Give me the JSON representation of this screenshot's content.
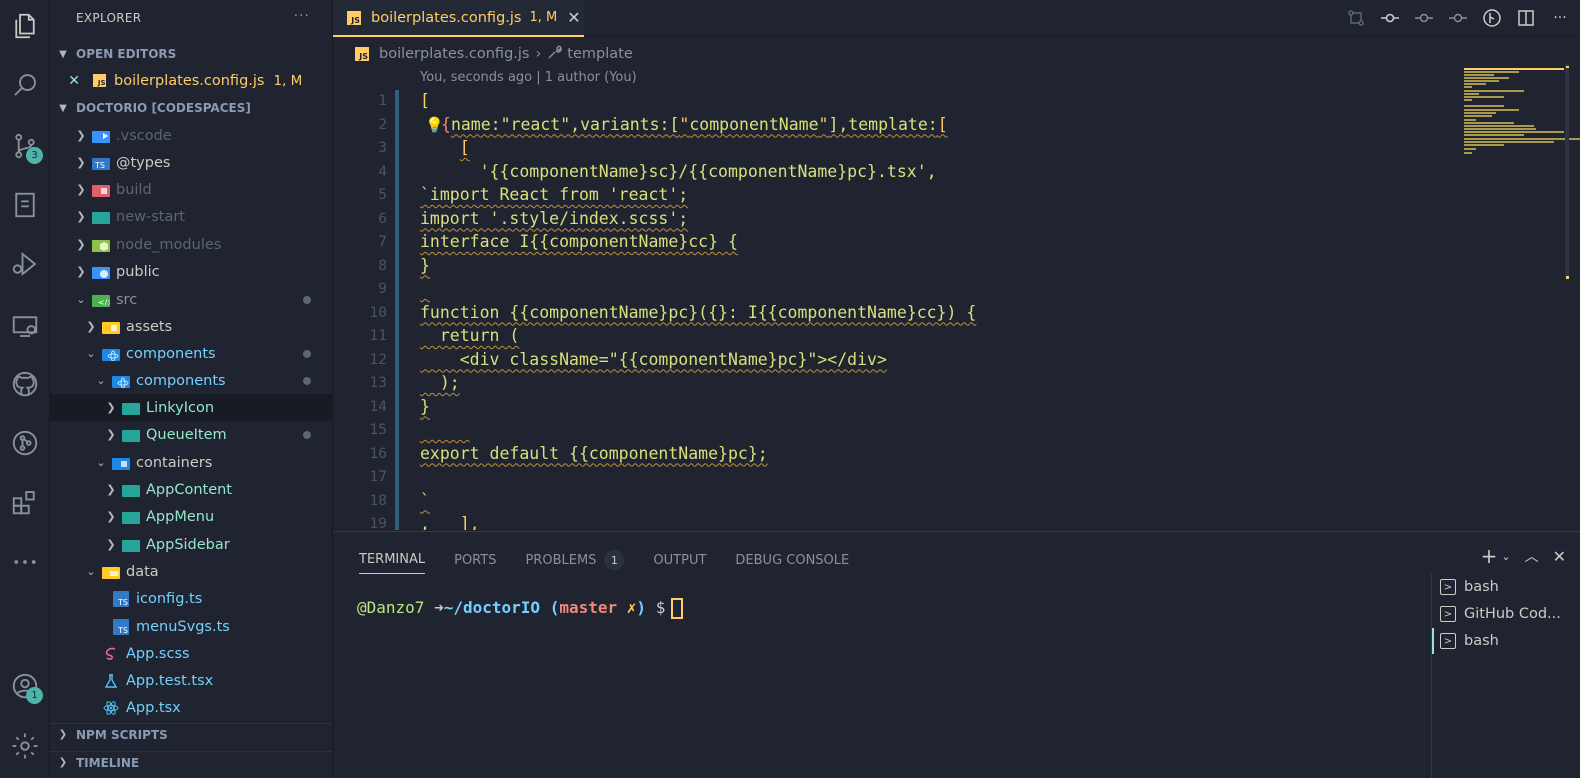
{
  "explorer": {
    "title": "EXPLORER",
    "more": "···",
    "open_editors": {
      "label": "OPEN EDITORS",
      "file": "boilerplates.config.js",
      "status": "1, M"
    },
    "workspace": {
      "label": "DOCTORIO [CODESPACES]"
    },
    "tree": [
      {
        "label": ".vscode"
      },
      {
        "label": "@types"
      },
      {
        "label": "build"
      },
      {
        "label": "new-start"
      },
      {
        "label": "node_modules"
      },
      {
        "label": "public"
      },
      {
        "label": "src"
      },
      {
        "label": "assets"
      },
      {
        "label": "components"
      },
      {
        "label": "components"
      },
      {
        "label": "LinkyIcon"
      },
      {
        "label": "QueueItem"
      },
      {
        "label": "containers"
      },
      {
        "label": "AppContent"
      },
      {
        "label": "AppMenu"
      },
      {
        "label": "AppSidebar"
      },
      {
        "label": "data"
      },
      {
        "label": "iconfig.ts"
      },
      {
        "label": "menuSvgs.ts"
      },
      {
        "label": "App.scss"
      },
      {
        "label": "App.test.tsx"
      },
      {
        "label": "App.tsx"
      }
    ],
    "npm_scripts": "NPM SCRIPTS",
    "timeline": "TIMELINE"
  },
  "activity": {
    "scm_badge": "3",
    "account_badge": "1"
  },
  "tab": {
    "name": "boilerplates.config.js",
    "status": "1, M",
    "file_icon": "JS"
  },
  "breadcrumb": {
    "file": "boilerplates.config.js",
    "symbol": "template"
  },
  "blame": "You, seconds ago | 1 author (You)",
  "code": {
    "line_numbers": [
      "1",
      "2",
      "3",
      "4",
      "5",
      "6",
      "7",
      "8",
      "9",
      "10",
      "11",
      "12",
      "13",
      "14",
      "15",
      "16",
      "17",
      "18",
      "19"
    ]
  },
  "panel": {
    "tabs": [
      "TERMINAL",
      "PORTS",
      "PROBLEMS",
      "OUTPUT",
      "DEBUG CONSOLE"
    ],
    "problems_count": "1",
    "terminal": {
      "user": "@Danzo7",
      "arrow": "➜",
      "path": "~/doctorIO",
      "branch": "master",
      "dirty": "✗",
      "prompt": "$"
    },
    "terminals": [
      "bash",
      "GitHub Cod...",
      "bash"
    ]
  }
}
